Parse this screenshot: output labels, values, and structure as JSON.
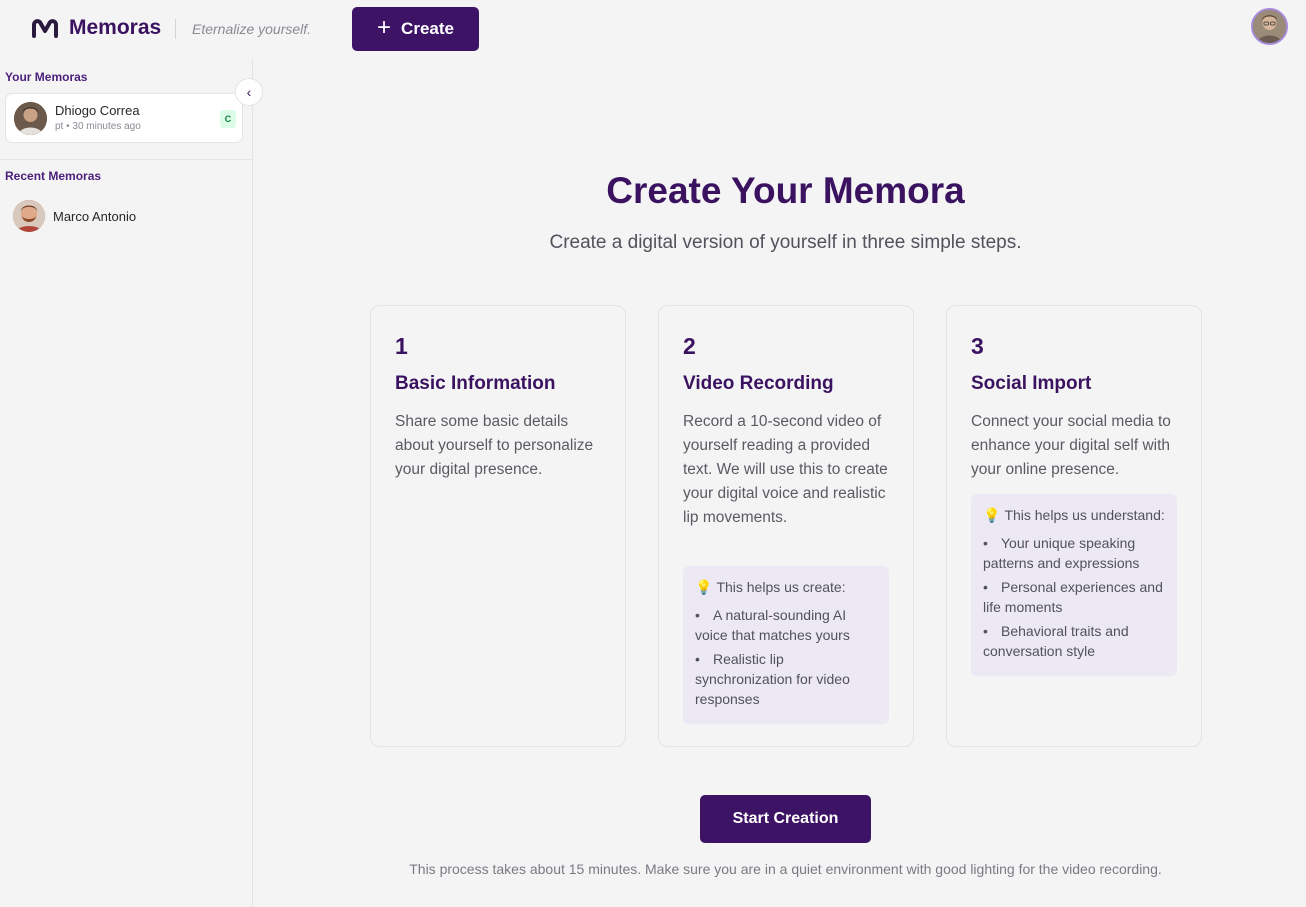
{
  "header": {
    "brand": "Memoras",
    "tagline": "Eternalize yourself.",
    "create_label": "Create"
  },
  "sidebar": {
    "your_memoras_title": "Your Memoras",
    "your_memoras": [
      {
        "name": "Dhiogo Correa",
        "meta": "pt • 30 minutes ago",
        "badge": "C"
      }
    ],
    "recent_title": "Recent Memoras",
    "recent": [
      {
        "name": "Marco Antonio"
      }
    ]
  },
  "main": {
    "title": "Create Your Memora",
    "subtitle": "Create a digital version of yourself in three simple steps.",
    "steps": [
      {
        "number": "1",
        "title": "Basic Information",
        "description": "Share some basic details about yourself to personalize your digital presence."
      },
      {
        "number": "2",
        "title": "Video Recording",
        "description": "Record a 10-second video of yourself reading a provided text. We will use this to create your digital voice and realistic lip movements.",
        "info_head": "This helps us create:",
        "info_items": [
          "A natural-sounding AI voice that matches yours",
          "Realistic lip synchronization for video responses"
        ]
      },
      {
        "number": "3",
        "title": "Social Import",
        "description": "Connect your social media to enhance your digital self with your online presence.",
        "info_head": "This helps us understand:",
        "info_items": [
          "Your unique speaking patterns and expressions",
          "Personal experiences and life moments",
          "Behavioral traits and conversation style"
        ]
      }
    ],
    "start_label": "Start Creation",
    "footnote": "This process takes about 15 minutes. Make sure you are in a quiet environment with good lighting for the video recording."
  },
  "colors": {
    "brand": "#3d1366",
    "heading": "#3b1260",
    "info_bg": "#ece9f5",
    "badge_bg": "#dcfce7",
    "badge_text": "#15803d"
  }
}
